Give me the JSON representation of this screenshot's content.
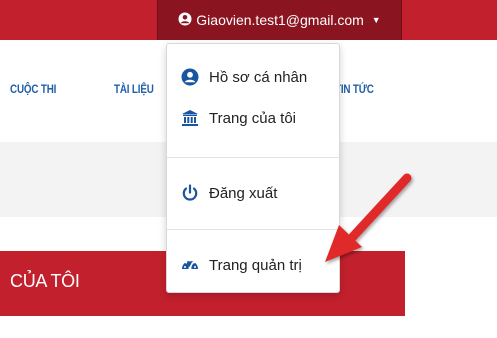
{
  "header": {
    "user_email": "Giaovien.test1@gmail.com",
    "user_icon": "user-circle-icon",
    "caret_icon": "caret-down-icon"
  },
  "nav": {
    "items": [
      {
        "label": "CUỘC THI"
      },
      {
        "label": "TÀI LIỆU"
      },
      {
        "label": "TIN TỨC"
      }
    ]
  },
  "section": {
    "title": "CỦA TÔI"
  },
  "dropdown": {
    "items": [
      {
        "label": "Hồ sơ cá nhân",
        "icon": "user-circle-icon"
      },
      {
        "label": "Trang của tôi",
        "icon": "bank-icon"
      },
      {
        "label": "Đăng xuất",
        "icon": "power-icon"
      },
      {
        "label": "Trang quản trị",
        "icon": "dashboard-icon"
      }
    ]
  },
  "colors": {
    "brand_red": "#c3202d",
    "dark_red": "#8a1520",
    "nav_blue": "#1f5fa8",
    "icon_blue": "#1a55a0",
    "arrow_red": "#e02a2a"
  }
}
